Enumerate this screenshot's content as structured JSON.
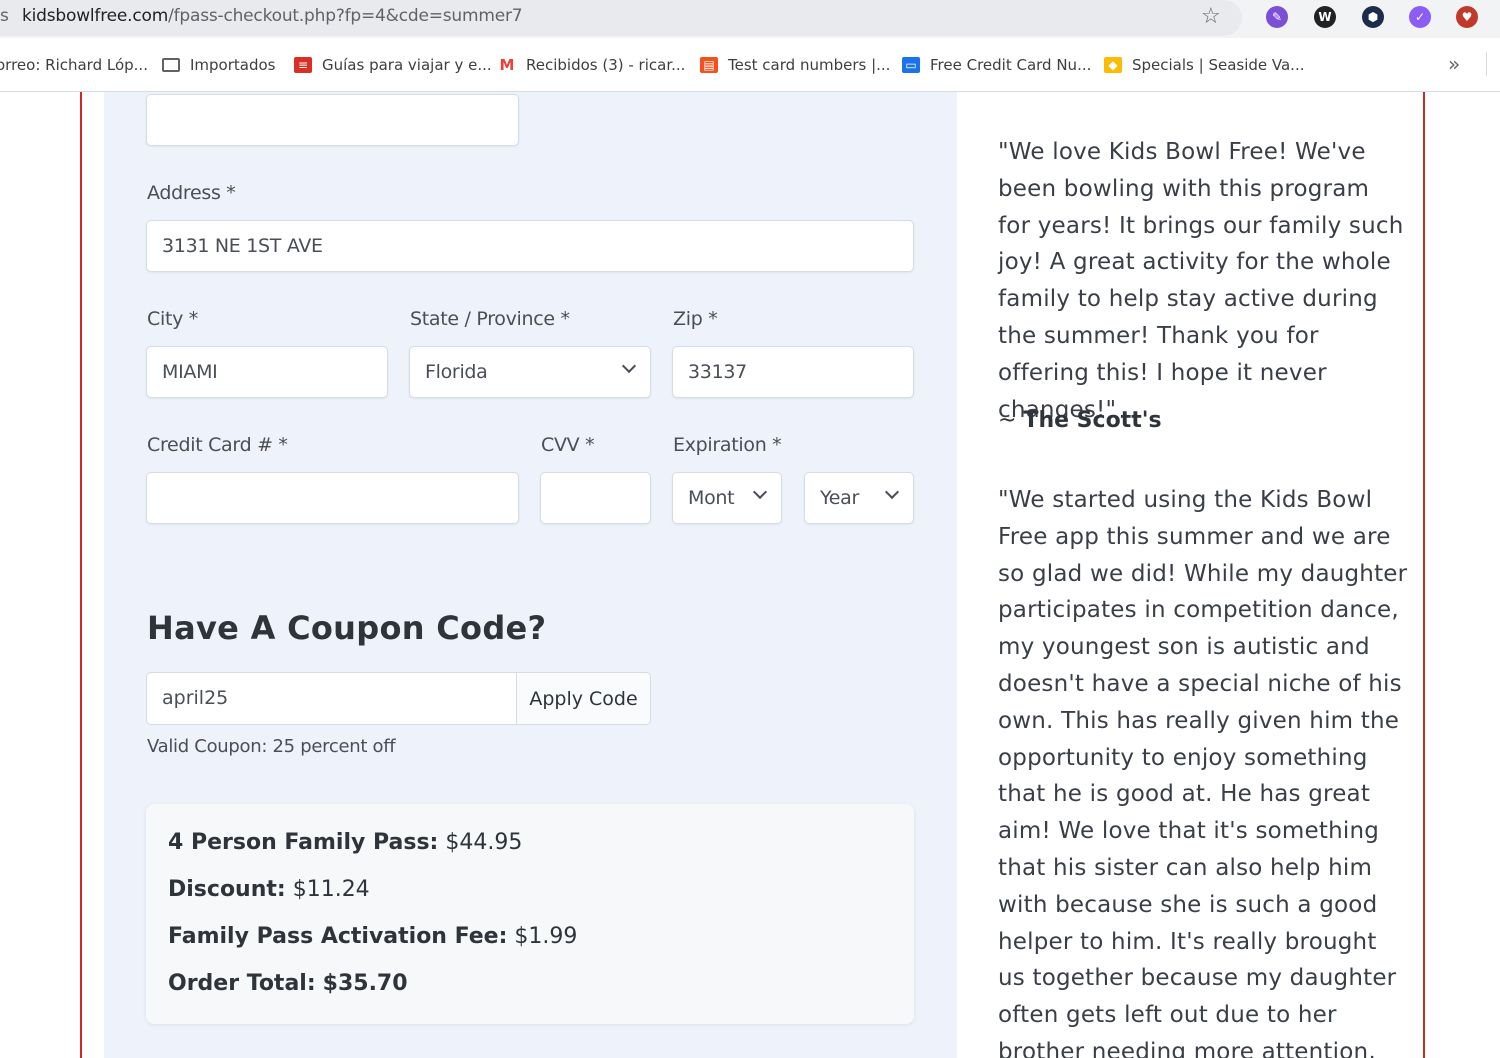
{
  "browser": {
    "url_host": "kidsbowlfree.com",
    "url_path": "/fpass-checkout.php?fp=4&cde=summer7",
    "bookmarks": [
      {
        "label": "orreo: Richard Lóp...",
        "icon": "mail-icon",
        "color": "#5f6368"
      },
      {
        "label": "Importados",
        "icon": "folder-icon",
        "color": "#5f6368"
      },
      {
        "label": "Guías para viajar y e...",
        "icon": "guide-icon",
        "color": "#d93025"
      },
      {
        "label": "Recibidos (3) - ricar...",
        "icon": "gmail-icon",
        "color": "#ea4335"
      },
      {
        "label": "Test card numbers |...",
        "icon": "card-icon",
        "color": "#f4511e"
      },
      {
        "label": "Free Credit Card Nu...",
        "icon": "credit-icon",
        "color": "#1a73e8"
      },
      {
        "label": "Specials | Seaside Va...",
        "icon": "specials-icon",
        "color": "#fbbc04"
      }
    ],
    "extensions": [
      {
        "name": "pen-extension-icon",
        "color": "#7b4fd6",
        "glyph": "✎"
      },
      {
        "name": "wordpress-extension-icon",
        "color": "#222222",
        "glyph": "W"
      },
      {
        "name": "hex-extension-icon",
        "color": "#1c2c4c",
        "glyph": "⬢"
      },
      {
        "name": "purple-extension-icon",
        "color": "#8b5cf6",
        "glyph": "✓"
      },
      {
        "name": "puzzle-extension-icon",
        "color": "#c0392b",
        "glyph": "♥"
      }
    ]
  },
  "form": {
    "address": {
      "label": "Address *",
      "value": "3131 NE 1ST AVE"
    },
    "city": {
      "label": "City *",
      "value": "MIAMI"
    },
    "state": {
      "label": "State / Province *",
      "value": "Florida"
    },
    "zip": {
      "label": "Zip *",
      "value": "33137"
    },
    "card": {
      "label": "Credit Card # *",
      "value": ""
    },
    "cvv": {
      "label": "CVV *",
      "value": ""
    },
    "expiration": {
      "label": "Expiration *",
      "month": "Mont",
      "year": "Year"
    }
  },
  "coupon": {
    "title": "Have A Coupon Code?",
    "value": "april25",
    "button": "Apply Code",
    "status": "Valid Coupon: 25 percent off"
  },
  "summary": {
    "pass_label": "4 Person Family Pass:",
    "pass_value": "$44.95",
    "discount_label": "Discount:",
    "discount_value": "$11.24",
    "fee_label": "Family Pass Activation Fee:",
    "fee_value": "$1.99",
    "total_label": "Order Total:",
    "total_value": "$35.70"
  },
  "testimonials": {
    "first": "\"We love Kids Bowl Free! We've been bowling with this program for years! It brings our family such joy! A great activity for the whole family to help stay active during the summer! Thank you for offering this! I hope it never changes!\"",
    "first_author_prefix": "~",
    "first_author": "The Scott's",
    "second": "\"We started using the Kids Bowl Free app this summer and we are so glad we did! While my daughter participates in competition dance, my youngest son is autistic and doesn't have a special niche of his own. This has really given him the opportunity to enjoy something that he is good at. He has great aim! We love that it's something that his sister can also help him with because she is such a good helper to him. It's really brought us together because my daughter often gets left out due to her brother needing more attention, and he gets left out of"
  }
}
